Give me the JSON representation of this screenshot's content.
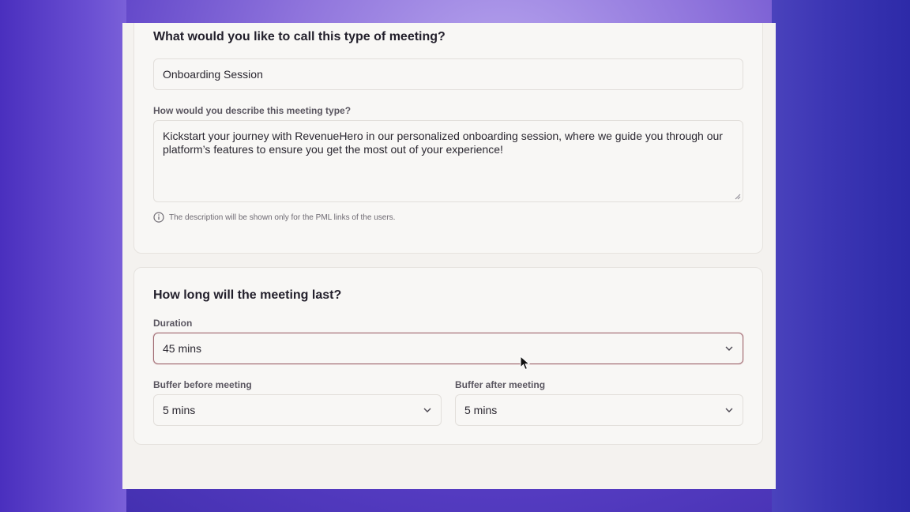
{
  "section_name": {
    "heading": "What would you like to call this type of meeting?",
    "name_value": "Onboarding Session",
    "description_label": "How would you describe this meeting type?",
    "description_value": "Kickstart your journey with RevenueHero in our personalized onboarding session, where we guide you through our platform’s features to ensure you get the most out of your experience!",
    "hint": "The description will be shown only for the PML links of the users."
  },
  "section_duration": {
    "heading": "How long will the meeting last?",
    "duration_label": "Duration",
    "duration_value": "45 mins",
    "buffer_before_label": "Buffer before meeting",
    "buffer_before_value": "5 mins",
    "buffer_after_label": "Buffer after meeting",
    "buffer_after_value": "5 mins"
  },
  "icons": [
    "info-icon",
    "chevron-down-icon",
    "resize-handle-icon",
    "mouse-cursor-icon"
  ],
  "colors": {
    "focus_border": "#a06a72",
    "heading_text": "#221f2b",
    "card_bg": "#f8f7f5"
  }
}
